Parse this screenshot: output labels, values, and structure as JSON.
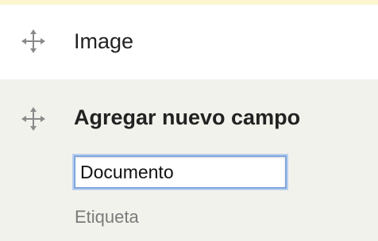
{
  "rows": {
    "image": {
      "label": "Image",
      "handle_icon": "drag-handle-icon"
    },
    "add_field": {
      "label": "Agregar nuevo campo",
      "handle_icon": "drag-handle-icon",
      "input": {
        "value": "Documento",
        "placeholder": ""
      },
      "description": "Etiqueta"
    }
  },
  "colors": {
    "top_strip": "#fbf6cf",
    "row_alt_background": "#f2f2ec",
    "input_focus_border": "#7fa6de",
    "description_text": "#7a7a7a"
  }
}
